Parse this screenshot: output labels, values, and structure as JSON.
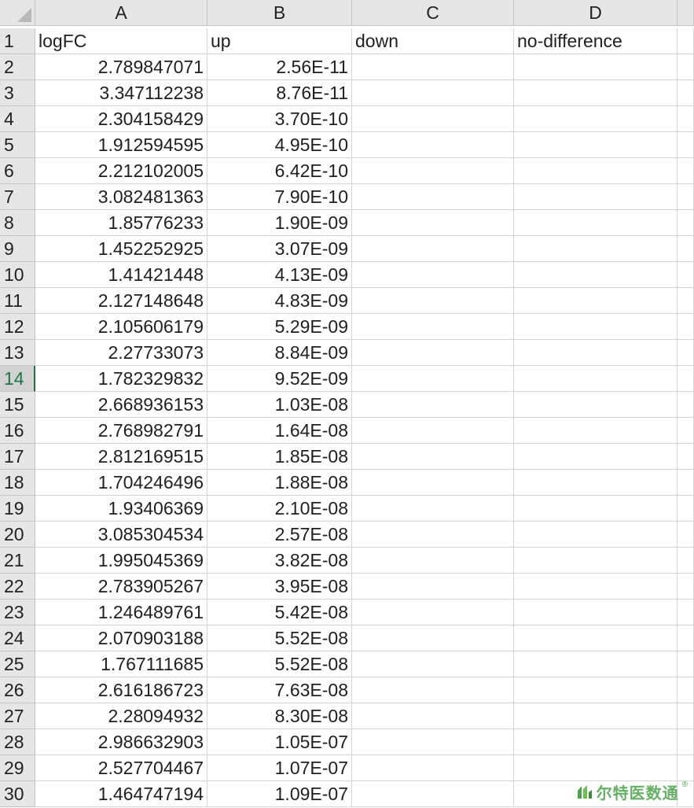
{
  "columns": [
    "A",
    "B",
    "C",
    "D"
  ],
  "active_row": 14,
  "rows": [
    {
      "n": "1",
      "cells": [
        "logFC",
        "up",
        "down",
        "no-difference"
      ]
    },
    {
      "n": "2",
      "cells": [
        "2.789847071",
        "2.56E-11",
        "",
        ""
      ]
    },
    {
      "n": "3",
      "cells": [
        "3.347112238",
        "8.76E-11",
        "",
        ""
      ]
    },
    {
      "n": "4",
      "cells": [
        "2.304158429",
        "3.70E-10",
        "",
        ""
      ]
    },
    {
      "n": "5",
      "cells": [
        "1.912594595",
        "4.95E-10",
        "",
        ""
      ]
    },
    {
      "n": "6",
      "cells": [
        "2.212102005",
        "6.42E-10",
        "",
        ""
      ]
    },
    {
      "n": "7",
      "cells": [
        "3.082481363",
        "7.90E-10",
        "",
        ""
      ]
    },
    {
      "n": "8",
      "cells": [
        "1.85776233",
        "1.90E-09",
        "",
        ""
      ]
    },
    {
      "n": "9",
      "cells": [
        "1.452252925",
        "3.07E-09",
        "",
        ""
      ]
    },
    {
      "n": "10",
      "cells": [
        "1.41421448",
        "4.13E-09",
        "",
        ""
      ]
    },
    {
      "n": "11",
      "cells": [
        "2.127148648",
        "4.83E-09",
        "",
        ""
      ]
    },
    {
      "n": "12",
      "cells": [
        "2.105606179",
        "5.29E-09",
        "",
        ""
      ]
    },
    {
      "n": "13",
      "cells": [
        "2.27733073",
        "8.84E-09",
        "",
        ""
      ]
    },
    {
      "n": "14",
      "cells": [
        "1.782329832",
        "9.52E-09",
        "",
        ""
      ]
    },
    {
      "n": "15",
      "cells": [
        "2.668936153",
        "1.03E-08",
        "",
        ""
      ]
    },
    {
      "n": "16",
      "cells": [
        "2.768982791",
        "1.64E-08",
        "",
        ""
      ]
    },
    {
      "n": "17",
      "cells": [
        "2.812169515",
        "1.85E-08",
        "",
        ""
      ]
    },
    {
      "n": "18",
      "cells": [
        "1.704246496",
        "1.88E-08",
        "",
        ""
      ]
    },
    {
      "n": "19",
      "cells": [
        "1.93406369",
        "2.10E-08",
        "",
        ""
      ]
    },
    {
      "n": "20",
      "cells": [
        "3.085304534",
        "2.57E-08",
        "",
        ""
      ]
    },
    {
      "n": "21",
      "cells": [
        "1.995045369",
        "3.82E-08",
        "",
        ""
      ]
    },
    {
      "n": "22",
      "cells": [
        "2.783905267",
        "3.95E-08",
        "",
        ""
      ]
    },
    {
      "n": "23",
      "cells": [
        "1.246489761",
        "5.42E-08",
        "",
        ""
      ]
    },
    {
      "n": "24",
      "cells": [
        "2.070903188",
        "5.52E-08",
        "",
        ""
      ]
    },
    {
      "n": "25",
      "cells": [
        "1.767111685",
        "5.52E-08",
        "",
        ""
      ]
    },
    {
      "n": "26",
      "cells": [
        "2.616186723",
        "7.63E-08",
        "",
        ""
      ]
    },
    {
      "n": "27",
      "cells": [
        "2.28094932",
        "8.30E-08",
        "",
        ""
      ]
    },
    {
      "n": "28",
      "cells": [
        "2.986632903",
        "1.05E-07",
        "",
        ""
      ]
    },
    {
      "n": "29",
      "cells": [
        "2.527704467",
        "1.07E-07",
        "",
        ""
      ]
    },
    {
      "n": "30",
      "cells": [
        "1.464747194",
        "1.09E-07",
        "",
        ""
      ]
    }
  ],
  "watermark": {
    "text": "尔特医数通",
    "reg": "®"
  }
}
